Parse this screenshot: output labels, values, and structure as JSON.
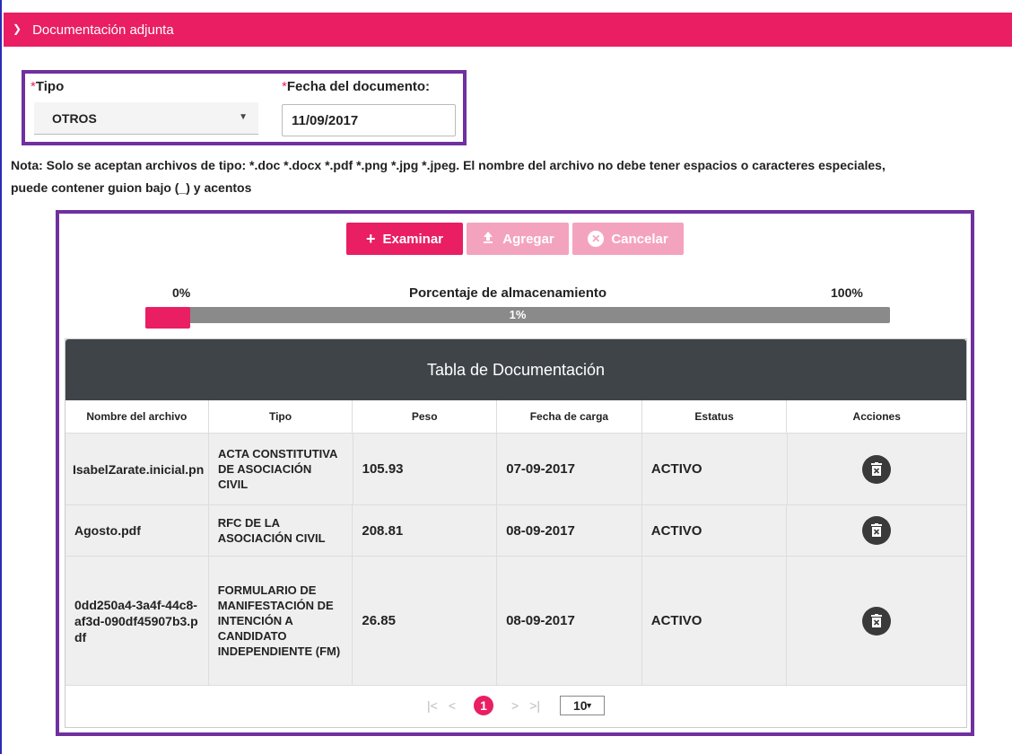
{
  "section": {
    "title": "Documentación adjunta"
  },
  "form": {
    "tipo_label": "Tipo",
    "tipo_value": "OTROS",
    "fecha_label": "Fecha del documento:",
    "fecha_value": "11/09/2017",
    "required_mark": "*"
  },
  "note": "Nota: Solo se aceptan archivos de tipo: *.doc *.docx *.pdf *.png *.jpg *.jpeg. El nombre del archivo no debe tener espacios o caracteres especiales, puede contener guion bajo (_) y acentos",
  "buttons": {
    "examinar": "Examinar",
    "agregar": "Agregar",
    "cancelar": "Cancelar"
  },
  "storage": {
    "min": "0%",
    "title": "Porcentaje de almacenamiento",
    "max": "100%",
    "value_label": "1%",
    "fill_fraction": 0.06
  },
  "table": {
    "caption": "Tabla de Documentación",
    "headers": [
      "Nombre del archivo",
      "Tipo",
      "Peso",
      "Fecha de carga",
      "Estatus",
      "Acciones"
    ],
    "rows": [
      {
        "nombre": "IsabelZarate.inicial.pn",
        "tipo": "ACTA CONSTITUTIVA DE ASOCIACIÓN CIVIL",
        "peso": "105.93",
        "fecha": "07-09-2017",
        "estatus": "ACTIVO"
      },
      {
        "nombre": "Agosto.pdf",
        "tipo": "RFC DE LA ASOCIACIÓN CIVIL",
        "peso": "208.81",
        "fecha": "08-09-2017",
        "estatus": "ACTIVO"
      },
      {
        "nombre": "0dd250a4-3a4f-44c8-af3d-090df45907b3.pdf",
        "tipo": "FORMULARIO DE MANIFESTACIÓN DE INTENCIÓN A CANDIDATO INDEPENDIENTE (FM)",
        "peso": "26.85",
        "fecha": "08-09-2017",
        "estatus": "ACTIVO"
      }
    ]
  },
  "pager": {
    "first": "|<",
    "prev": "<",
    "current": "1",
    "next": ">",
    "last": ">|",
    "page_size": "10"
  },
  "colors": {
    "accent": "#e91e63",
    "highlight_border": "#7030a0",
    "table_header": "#3f4449"
  }
}
